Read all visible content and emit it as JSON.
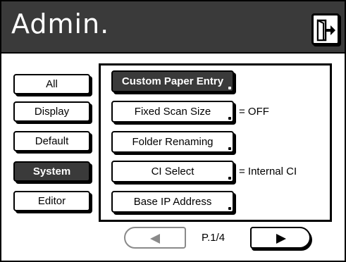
{
  "header": {
    "title": "Admin.",
    "exit_icon": "exit-door-icon"
  },
  "sidebar": {
    "items": [
      {
        "label": "All",
        "active": false
      },
      {
        "label": "Display",
        "active": false
      },
      {
        "label": "Default",
        "active": false
      },
      {
        "label": "System",
        "active": true
      },
      {
        "label": "Editor",
        "active": false
      }
    ]
  },
  "functions": {
    "items": [
      {
        "label": "Custom Paper Entry",
        "value": "",
        "active": true
      },
      {
        "label": "Fixed Scan Size",
        "value": "= OFF",
        "active": false
      },
      {
        "label": "Folder Renaming",
        "value": "",
        "active": false
      },
      {
        "label": "CI Select",
        "value": "= Internal CI",
        "active": false
      },
      {
        "label": "Base IP Address",
        "value": "",
        "active": false
      }
    ]
  },
  "pager": {
    "label": "P.1/4",
    "prev_icon": "left-arrow-icon",
    "next_icon": "right-arrow-icon",
    "prev_enabled": false
  },
  "colors": {
    "header_bg": "#3a3a3a",
    "active_bg": "#3a3a3a",
    "disabled": "#8a8a8a"
  }
}
